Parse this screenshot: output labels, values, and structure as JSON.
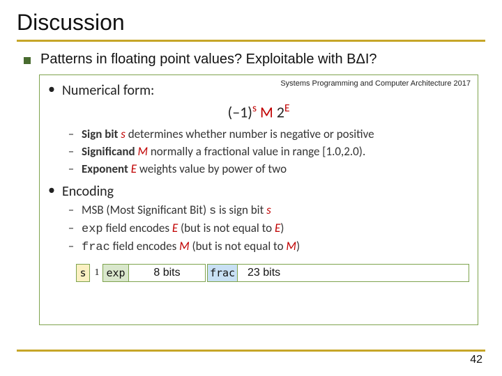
{
  "title": "Discussion",
  "bullet1": "Patterns in floating point values? Exploitable with BΔI?",
  "cite": "Systems Programming and Computer Architecture 2017",
  "sec1": {
    "label": "Numerical form:"
  },
  "formula": {
    "neg1": "(–1)",
    "s": "s",
    "M": " M ",
    "two": "2",
    "E": "E"
  },
  "lines1": {
    "sign": {
      "b": "Sign bit ",
      "var": "s",
      "rest": " determines whether number is negative or positive"
    },
    "sig": {
      "b": "Significand ",
      "var": "M",
      "rest": " normally a fractional value in range [1.0,2.0)."
    },
    "exp": {
      "b": "Exponent ",
      "var": "E",
      "rest": " weights value by power of two"
    }
  },
  "sec2": {
    "label": "Encoding"
  },
  "lines2": {
    "msb": {
      "a": "MSB (Most Significant Bit) ",
      "mono": "s",
      "b": " is sign bit ",
      "var": "s"
    },
    "exp": {
      "mono": "exp",
      "a": " field encodes ",
      "var1": "E",
      "b": " (but is not equal to ",
      "var2": "E",
      "c": ")"
    },
    "frac": {
      "mono": "frac",
      "a": " field encodes ",
      "var1": "M",
      "b": " (but is not equal to ",
      "var2": "M",
      "c": ")"
    }
  },
  "diagram": {
    "s": "s",
    "one": "1",
    "exp": "exp",
    "exp_w": "8 bits",
    "frac": "frac",
    "frac_w": "23 bits"
  },
  "page": "42"
}
